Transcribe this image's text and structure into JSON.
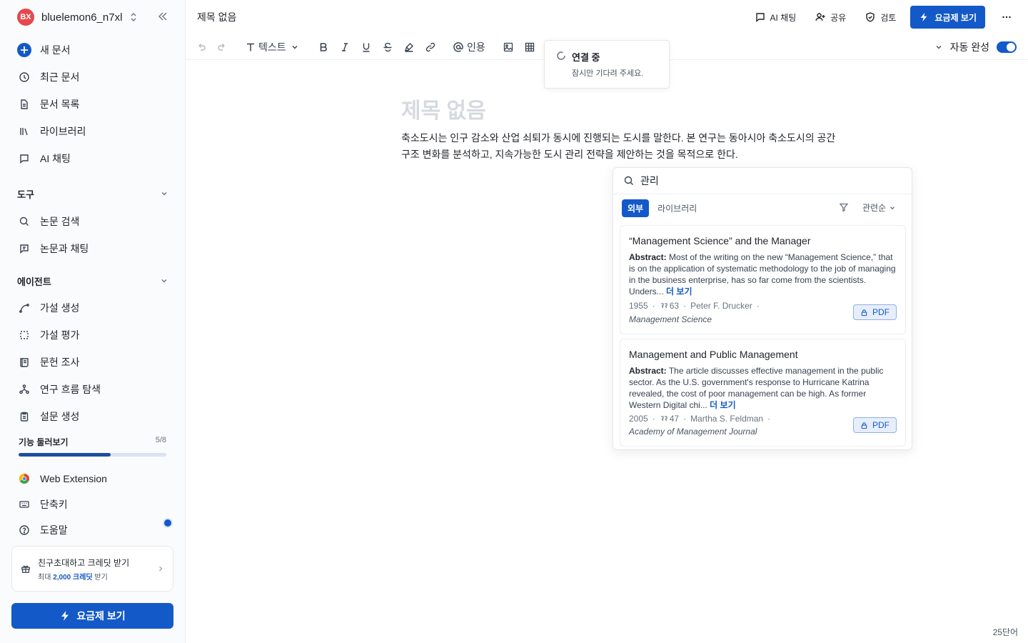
{
  "workspace": {
    "initials": "BX",
    "name": "bluelemon6_n7xl"
  },
  "sidebar": {
    "main_items": [
      {
        "label": "새 문서",
        "icon": "plus-circle-icon"
      },
      {
        "label": "최근 문서",
        "icon": "clock-icon"
      },
      {
        "label": "문서 목록",
        "icon": "document-icon"
      },
      {
        "label": "라이브러리",
        "icon": "library-icon"
      },
      {
        "label": "AI 채팅",
        "icon": "chat-icon"
      }
    ],
    "tools": {
      "title": "도구",
      "items": [
        {
          "label": "논문 검색",
          "icon": "search-icon"
        },
        {
          "label": "논문과 채팅",
          "icon": "paper-chat-icon"
        }
      ]
    },
    "agents": {
      "title": "에이전트",
      "items": [
        {
          "label": "가설 생성",
          "icon": "curve-icon"
        },
        {
          "label": "가설 평가",
          "icon": "dashed-square-icon"
        },
        {
          "label": "문헌 조사",
          "icon": "scroll-icon"
        },
        {
          "label": "연구 흐름 탐색",
          "icon": "network-icon"
        },
        {
          "label": "설문 생성",
          "icon": "clipboard-icon"
        }
      ]
    },
    "tour": {
      "label": "기능 둘러보기",
      "count": "5/8",
      "progress": 0.625
    },
    "bottom_items": [
      {
        "label": "Web Extension",
        "icon": "chrome-icon"
      },
      {
        "label": "단축키",
        "icon": "keyboard-icon"
      },
      {
        "label": "도움말",
        "icon": "help-icon"
      }
    ],
    "invite": {
      "title": "친구초대하고 크레딧 받기",
      "sub_prefix": "최대",
      "sub_highlight": "2,000 크레딧",
      "sub_suffix": "받기"
    },
    "plan_button": "요금제 보기"
  },
  "topbar": {
    "doc_title": "제목 없음",
    "actions": {
      "ai_chat": "AI 채팅",
      "share": "공유",
      "review": "검토",
      "plan": "요금제 보기"
    }
  },
  "toolbar": {
    "text_style": "텍스트",
    "cite": "인용",
    "autosave": "자동 완성"
  },
  "toast": {
    "title": "연결 중",
    "message": "잠시만 기다려 주세요."
  },
  "editor": {
    "title_placeholder": "제목 없음",
    "body": "축소도시는 인구 감소와 산업 쇠퇴가 동시에 진행되는 도시를 말한다. 본 연구는 동아시아 축소도시의 공간 구조 변화를 분석하고, 지속가능한 도시 관리 전략을 제안하는 것을 목적으로 한다."
  },
  "citation_panel": {
    "query": "관리",
    "tabs": {
      "external": "외부",
      "library": "라이브러리"
    },
    "sort": "관련순",
    "results": [
      {
        "title": "“Management Science” and the Manager",
        "abstract_label": "Abstract:",
        "abstract": "Most of the writing on the new “Management Science,” that is on the application of systematic methodology to the job of managing in the business enterprise, has so far come from the scientists. Unders...",
        "more": "더 보기",
        "year": "1955",
        "citations": "63",
        "author": "Peter F. Drucker",
        "journal": "Management Science",
        "pdf": "PDF"
      },
      {
        "title": "Management and Public Management",
        "abstract_label": "Abstract:",
        "abstract": "The article discusses effective management in the public sector. As the U.S. government's response to Hurricane Katrina revealed, the cost of poor management can be high. As former Western Digital chi...",
        "more": "더 보기",
        "year": "2005",
        "citations": "47",
        "author": "Martha S. Feldman",
        "journal": "Academy of Management Journal",
        "pdf": "PDF"
      }
    ]
  },
  "word_count": "25단어",
  "colors": {
    "primary": "#1459c8",
    "avatar": "#e5484d",
    "placeholder": "#d6d9de"
  }
}
